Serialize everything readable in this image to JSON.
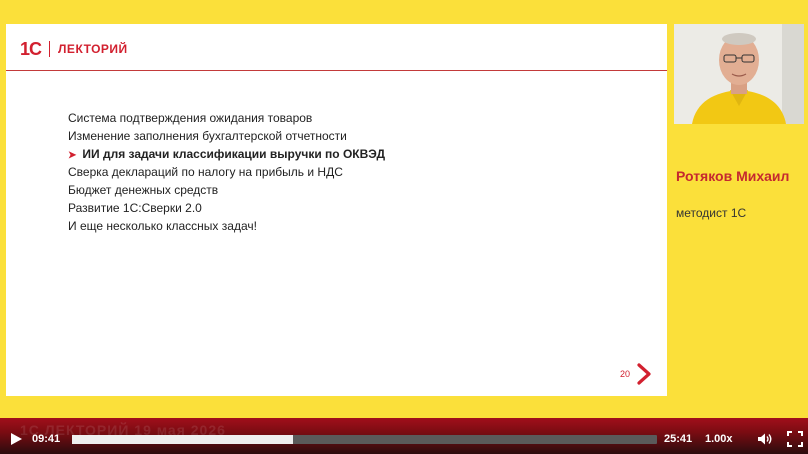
{
  "slide": {
    "logo_mark": "1С",
    "logo_text": "ЛЕКТОРИЙ",
    "items": [
      {
        "text": "Система подтверждения ожидания товаров"
      },
      {
        "text": "Изменение заполнения бухгалтерской отчетности"
      },
      {
        "text": "ИИ для задачи классификации выручки по ОКВЭД",
        "active": true
      },
      {
        "text": "Сверка деклараций по налогу на прибыль и НДС"
      },
      {
        "text": "Бюджет денежных средств"
      },
      {
        "text": "Развитие 1С:Сверки 2.0"
      },
      {
        "text": "И еще несколько классных задач!"
      }
    ],
    "page_number": "20",
    "next_icon": "chevron-right-icon"
  },
  "speaker": {
    "name": "Ротяков Михаил",
    "role": "методист 1С"
  },
  "player": {
    "watermark": "1С ЛЕКТОРИЙ 19 мая 2026",
    "current_time": "09:41",
    "total_time": "25:41",
    "speed": "1.00x",
    "progress": 0.377,
    "play_icon": "play-icon",
    "volume_icon": "volume-icon",
    "fullscreen_icon": "fullscreen-icon"
  },
  "colors": {
    "background": "#fbe03a",
    "accent": "#d2202f",
    "player_bar": "#8a0d15"
  }
}
